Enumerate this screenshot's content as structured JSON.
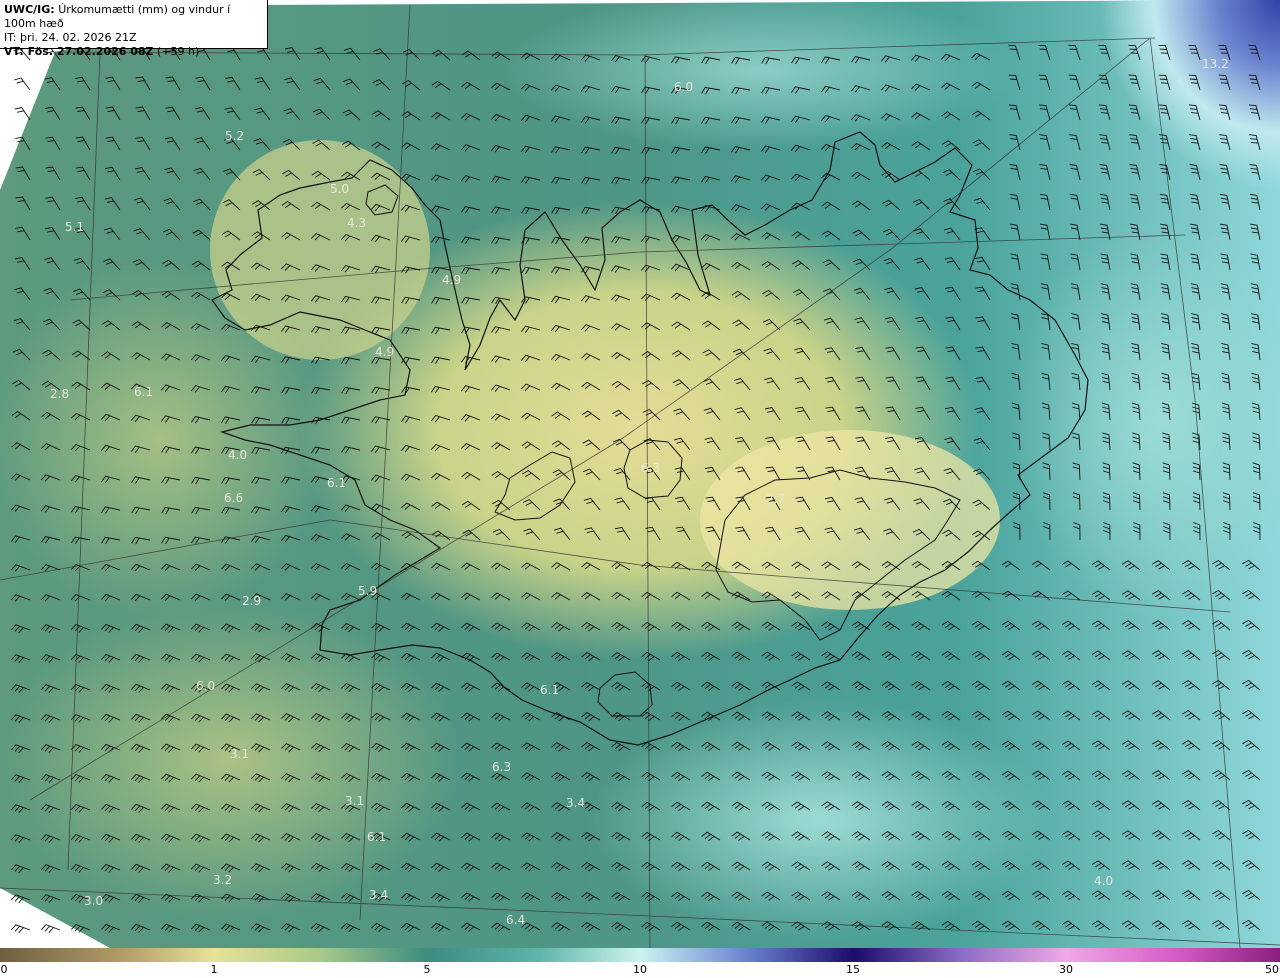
{
  "header": {
    "title_bold": "UWC/IG:",
    "title_rest": "Úrkomumætti (mm) og vindur í 100m hæð",
    "issue_time": "IT: þri. 24. 02. 2026 21Z",
    "valid_label": "VT: Fös. 27.02.2026 08Z",
    "valid_offset": "(+59 h)"
  },
  "colorbar": {
    "ticks": [
      "0",
      "1",
      "5",
      "10",
      "15",
      "30",
      "50"
    ],
    "colors": [
      "#7a6a4a",
      "#b9a76c",
      "#e6e197",
      "#c7d98f",
      "#6aa586",
      "#3b8c86",
      "#5fb3a6",
      "#c9f2ee",
      "#4a5bb8",
      "#22126f",
      "#c58ad2",
      "#ee8ede",
      "#9c2b8b"
    ]
  },
  "map": {
    "precip_labels": [
      "5.2",
      "5.1",
      "4.3",
      "4.9",
      "4.9",
      "6.1",
      "2.8",
      "6.1",
      "6.6",
      "2.9",
      "5.9",
      "6.0",
      "3.1",
      "3.1",
      "6.1",
      "6.3",
      "3.4",
      "6.1",
      "3.2",
      "3.0",
      "3.4",
      "6.4",
      "4.0",
      "13.2",
      "6.0",
      "5.0",
      "6.3",
      "2.7",
      "4.0"
    ]
  }
}
